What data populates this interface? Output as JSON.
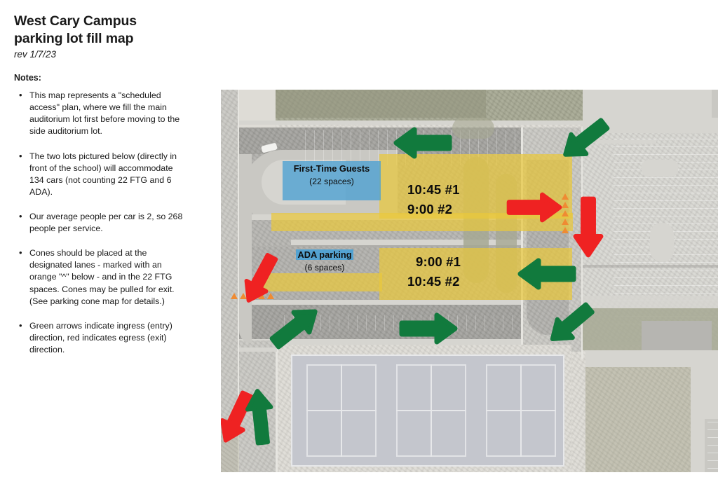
{
  "document": {
    "title_line1": "West Cary Campus",
    "title_line2": "parking lot fill map",
    "revision": "rev 1/7/23",
    "notes_heading": "Notes:",
    "notes": [
      "This map represents a \"scheduled access\" plan, where we fill the main auditorium lot first before moving to the side auditorium lot.",
      "The two lots pictured below (directly in front of the school) will accommodate 134 cars (not counting 22 FTG and 6 ADA).",
      "Our average people per car is 2, so 268 people per service.",
      "Cones should be placed at the designated lanes - marked with an orange \"^\" below - and in the 22 FTG spaces. Cones may be pulled for exit. (See parking cone map for details.)",
      "Green arrows indicate ingress (entry) direction, red indicates egress (exit) direction."
    ]
  },
  "map": {
    "labels": {
      "first_time_guests": {
        "name": "First-Time Guests",
        "capacity": "(22 spaces)"
      },
      "ada_parking": {
        "name": "ADA parking",
        "capacity": "(6 spaces)"
      }
    },
    "main_lot": {
      "line1": "10:45 #1",
      "line2": "9:00 #2"
    },
    "side_lot": {
      "line1": "9:00 #1",
      "line2": "10:45 #2"
    },
    "legend_colors": {
      "ingress_arrow": "#117a3d",
      "egress_arrow": "#ef2222",
      "lot_highlight": "#e9c83c",
      "guest_highlight": "#4ca0d2",
      "cone_marker": "#ef8b33"
    },
    "arrows": [
      {
        "id": "top-entry-west",
        "direction": "left",
        "type": "ingress"
      },
      {
        "id": "top-entry-east",
        "direction": "up-right",
        "type": "ingress"
      },
      {
        "id": "main-lot-exit",
        "direction": "right",
        "type": "egress"
      },
      {
        "id": "east-drive-exit",
        "direction": "down",
        "type": "egress"
      },
      {
        "id": "side-lot-entry",
        "direction": "left",
        "type": "ingress"
      },
      {
        "id": "south-entry-east",
        "direction": "up-right",
        "type": "ingress"
      },
      {
        "id": "south-drive-east",
        "direction": "right",
        "type": "ingress"
      },
      {
        "id": "south-drive-west",
        "direction": "up-right",
        "type": "ingress"
      },
      {
        "id": "ada-exit",
        "direction": "down-left",
        "type": "egress"
      },
      {
        "id": "southwest-exit",
        "direction": "down-left",
        "type": "egress"
      },
      {
        "id": "southwest-entry",
        "direction": "up",
        "type": "ingress"
      }
    ],
    "cone_markers": [
      {
        "id": "ada-lane-cones",
        "count": 5,
        "orientation": "horizontal"
      },
      {
        "id": "main-lane-cones",
        "count": 5,
        "orientation": "vertical"
      }
    ]
  }
}
